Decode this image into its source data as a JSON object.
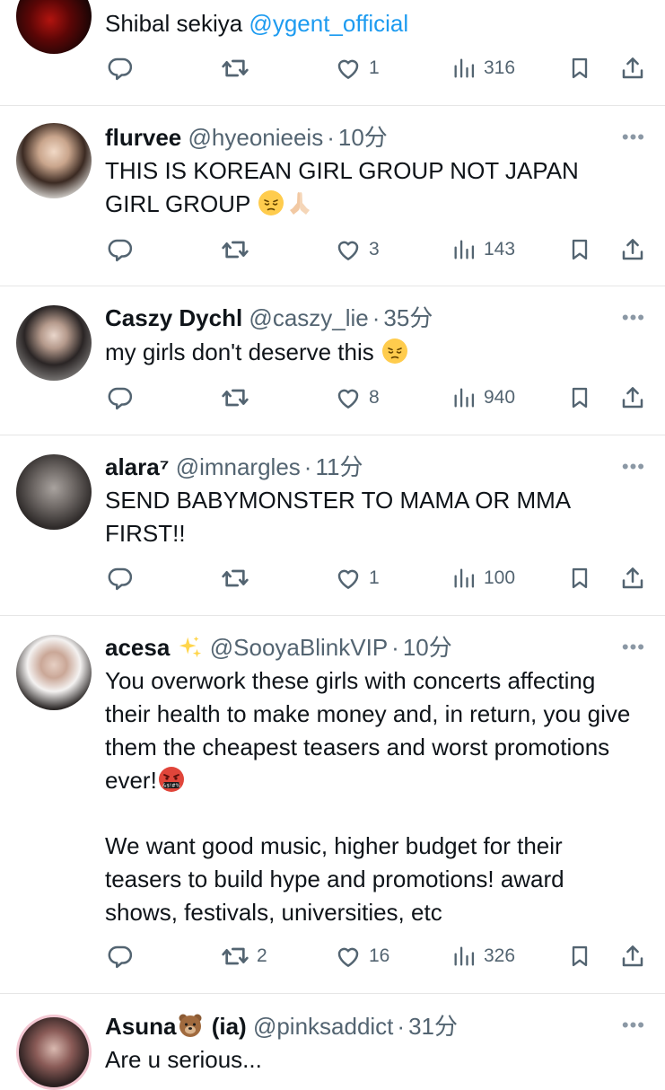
{
  "tweets": [
    {
      "name": "",
      "handle": "",
      "time": "",
      "text": "Shibal sekiya ",
      "mention": "@ygent_official",
      "replies": "",
      "retweets": "",
      "likes": "1",
      "views": "316"
    },
    {
      "name": "flurvee",
      "handle": "@hyeonieeis",
      "time": "10分",
      "text": "THIS IS KOREAN GIRL GROUP NOT JAPAN GIRL GROUP",
      "emojis": [
        "pensive-emoji",
        "folded-hands-emoji"
      ],
      "replies": "",
      "retweets": "",
      "likes": "3",
      "views": "143"
    },
    {
      "name": "Caszy Dychl",
      "handle": "@caszy_lie",
      "time": "35分",
      "text": "my girls don't deserve this",
      "emojis": [
        "pensive-emoji"
      ],
      "replies": "",
      "retweets": "",
      "likes": "8",
      "views": "940"
    },
    {
      "name": "alara⁷",
      "handle": "@imnargles",
      "time": "11分",
      "text": "SEND BABYMONSTER TO MAMA OR MMA FIRST!!",
      "replies": "",
      "retweets": "",
      "likes": "1",
      "views": "100"
    },
    {
      "name": "acesa",
      "name_emoji": "sparkles-emoji",
      "handle": "@SooyaBlinkVIP",
      "time": "10分",
      "text": "You overwork these girls with concerts affecting their health to make money and, in return, you give them the cheapest teasers and worst promotions ever!",
      "text2": "We want good music, higher budget for their teasers to build hype and promotions! award shows, festivals, universities, etc",
      "emojis": [
        "swearing-face-emoji"
      ],
      "replies": "",
      "retweets": "2",
      "likes": "16",
      "views": "326"
    },
    {
      "name": "Asuna",
      "name_emoji": "bear-emoji",
      "name_suffix": "(ia)",
      "handle": "@pinksaddict",
      "time": "31分",
      "text": "Are u serious..."
    }
  ],
  "ui": {
    "more_label": "•••",
    "dot": "·"
  },
  "colors": {
    "text": "#0f1419",
    "secondary": "#536471",
    "link": "#1d9bf0",
    "divider": "#e6e6e6"
  }
}
